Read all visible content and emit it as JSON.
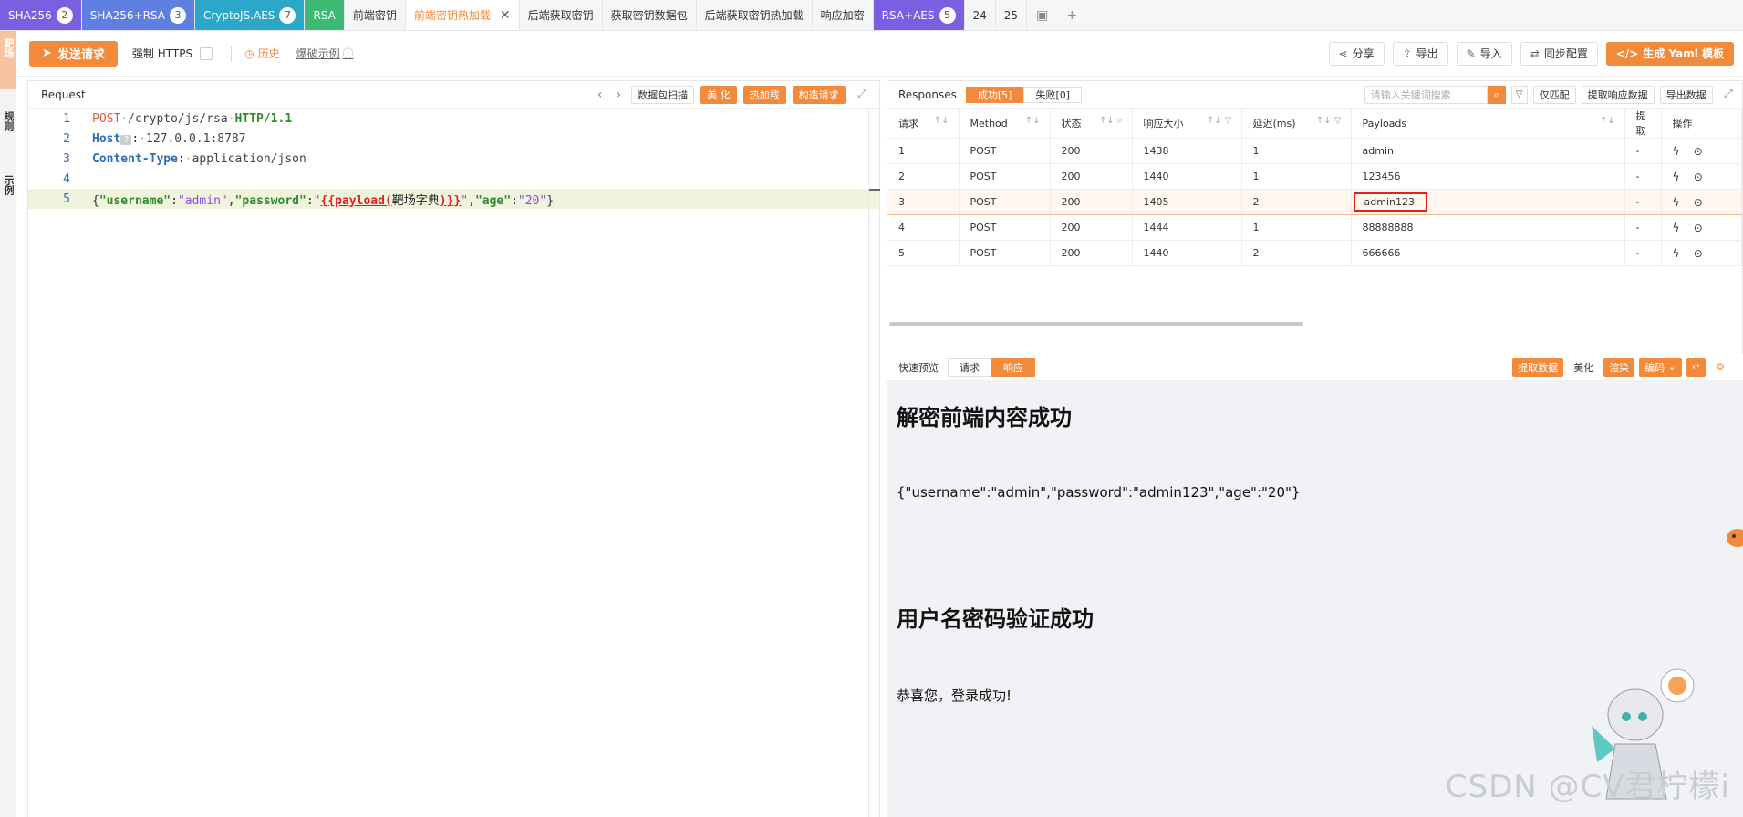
{
  "tabs": [
    {
      "label": "SHA256",
      "count": "2",
      "bg": "#7b5fe0",
      "fg": "#ffffff"
    },
    {
      "label": "SHA256+RSA",
      "count": "3",
      "bg": "#5f7fe0",
      "fg": "#ffffff"
    },
    {
      "label": "CryptoJS.AES",
      "count": "7",
      "bg": "#2ba7c9",
      "fg": "#ffffff"
    },
    {
      "label": "RSA",
      "count": "",
      "bg": "#3cbb74",
      "fg": "#ffffff"
    },
    {
      "label": "前端密钥",
      "count": "",
      "bg": "",
      "fg": ""
    },
    {
      "label": "前端密钥热加载",
      "count": "",
      "bg": "",
      "fg": "",
      "active": true
    },
    {
      "label": "后端获取密钥",
      "count": "",
      "bg": "",
      "fg": ""
    },
    {
      "label": "获取密钥数据包",
      "count": "",
      "bg": "",
      "fg": ""
    },
    {
      "label": "后端获取密钥热加载",
      "count": "",
      "bg": "",
      "fg": ""
    },
    {
      "label": "响应加密",
      "count": "",
      "bg": "",
      "fg": ""
    },
    {
      "label": "RSA+AES",
      "count": "5",
      "bg": "#7b5fe0",
      "fg": "#ffffff"
    },
    {
      "label": "24",
      "count": "",
      "bg": "",
      "fg": ""
    },
    {
      "label": "25",
      "count": "",
      "bg": "",
      "fg": ""
    }
  ],
  "rail": {
    "item1": "靶场",
    "item2": "规则",
    "item3": "示例"
  },
  "toolbar": {
    "send": "发送请求",
    "https": "强制 HTTPS",
    "history": "历史",
    "demo": "爆破示例",
    "share": "分享",
    "export": "导出",
    "import": "导入",
    "sync": "同步配置",
    "yaml": "生成 Yaml 模板"
  },
  "request": {
    "title": "Request",
    "tools": [
      "数据包扫描",
      "美 化",
      "热加载",
      "构造请求"
    ],
    "lines": [
      "1",
      "2",
      "3",
      "4",
      "5"
    ],
    "method": "POST",
    "path": "/crypto/js/rsa",
    "proto": "HTTP/1.1",
    "host_key": "Host",
    "host_val": "127.0.0.1:8787",
    "ct_key": "Content-Type",
    "ct_val": "application/json",
    "body": {
      "k_user": "\"username\"",
      "v_user": "\"admin\"",
      "k_pass": "\"password\"",
      "payload_open": "{{payload(",
      "payload_dict": "靶场字典",
      "payload_close": ")}}",
      "k_age": "\"age\"",
      "v_age": "\"20\""
    }
  },
  "responses": {
    "title": "Responses",
    "success": "成功[5]",
    "fail": "失败[0]",
    "search_placeholder": "请输入关键词搜索",
    "only_match": "仅匹配",
    "extract_resp": "提取响应数据",
    "export_data": "导出数据",
    "columns": [
      "请求",
      "Method",
      "状态",
      "响应大小",
      "延迟(ms)",
      "Payloads",
      "提取",
      "操作"
    ],
    "rows": [
      {
        "id": "1",
        "method": "POST",
        "status": "200",
        "size": "1438",
        "delay": "1",
        "payload": "admin",
        "extract": "-"
      },
      {
        "id": "2",
        "method": "POST",
        "status": "200",
        "size": "1440",
        "delay": "1",
        "payload": "123456",
        "extract": "-"
      },
      {
        "id": "3",
        "method": "POST",
        "status": "200",
        "size": "1405",
        "delay": "2",
        "payload": "admin123",
        "extract": "-"
      },
      {
        "id": "4",
        "method": "POST",
        "status": "200",
        "size": "1444",
        "delay": "1",
        "payload": "88888888",
        "extract": "-"
      },
      {
        "id": "5",
        "method": "POST",
        "status": "200",
        "size": "1440",
        "delay": "2",
        "payload": "666666",
        "extract": "-"
      }
    ]
  },
  "preview": {
    "title": "快速预览",
    "tab_req": "请求",
    "tab_resp": "响应",
    "extract": "提取数据",
    "beautify": "美化",
    "render": "渲染",
    "encode": "编码",
    "heading1": "解密前端内容成功",
    "json": "{\"username\":\"admin\",\"password\":\"admin123\",\"age\":\"20\"}",
    "heading2": "用户名密码验证成功",
    "message": "恭喜您，登录成功!",
    "watermark": "CSDN @CV君柠檬i"
  },
  "colors": {
    "accent": "#f28a3b",
    "status_ok": "#4caf50",
    "highlight_box": "#e02020"
  }
}
